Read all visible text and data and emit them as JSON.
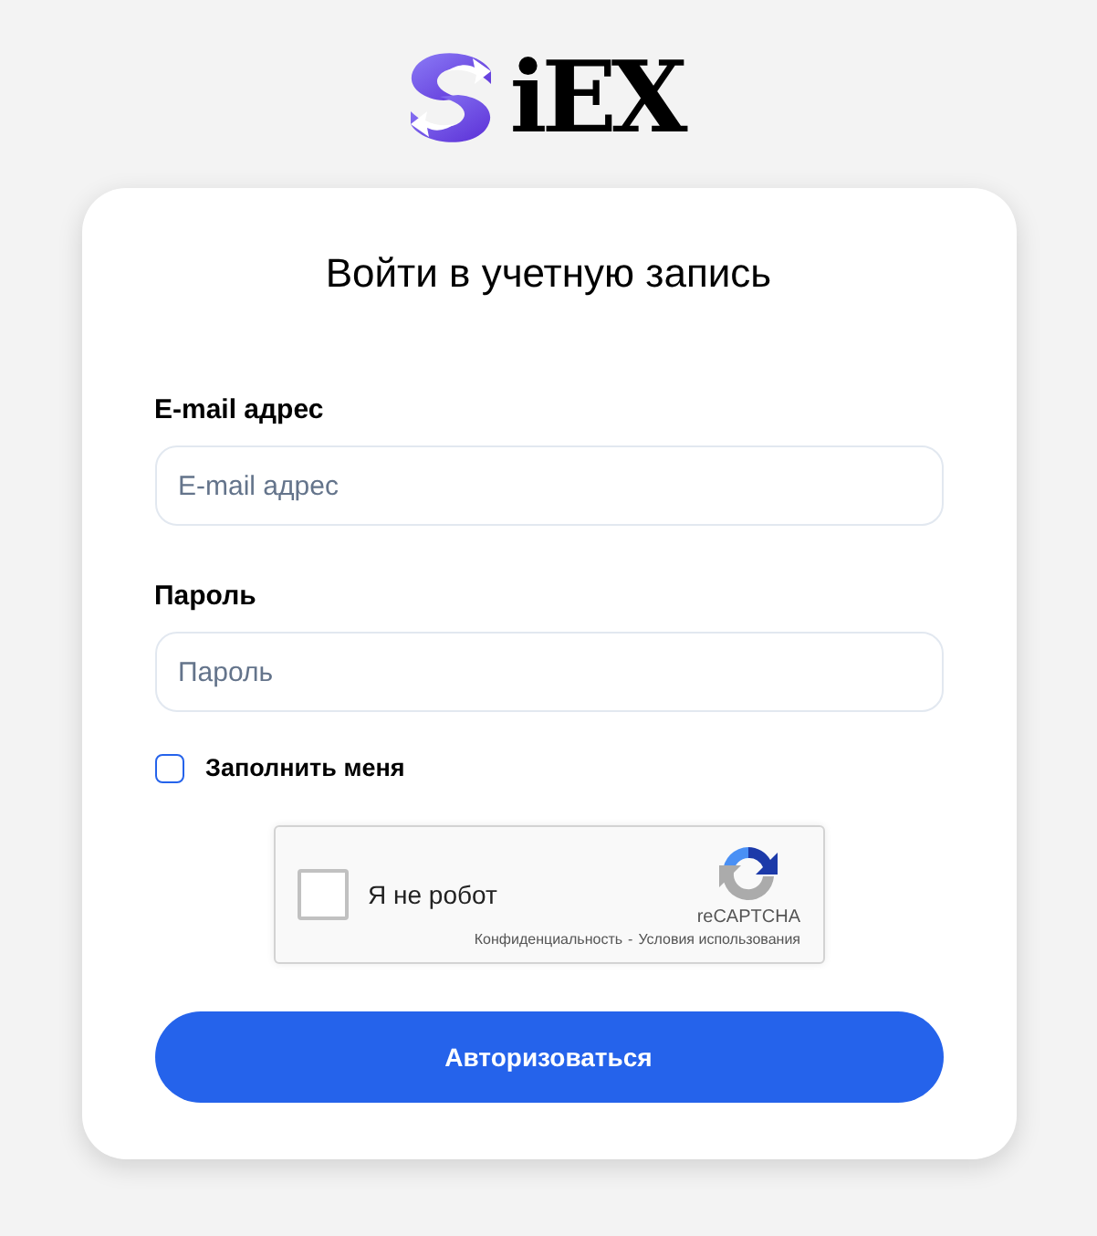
{
  "logo": {
    "text": "iEX"
  },
  "form": {
    "title": "Войти в учетную запись",
    "fields": [
      {
        "label": "E-mail адрес",
        "placeholder": "E-mail адрес"
      },
      {
        "label": "Пароль",
        "placeholder": "Пароль"
      }
    ],
    "remember": {
      "label": "Заполнить меня",
      "checked": false
    },
    "captcha": {
      "label": "Я не робот",
      "checked": false,
      "brand": "reCAPTCHA",
      "links": [
        "Конфиденциальность",
        "Условия использования"
      ],
      "separator": "-"
    },
    "submit": {
      "label": "Авторизоваться"
    }
  }
}
